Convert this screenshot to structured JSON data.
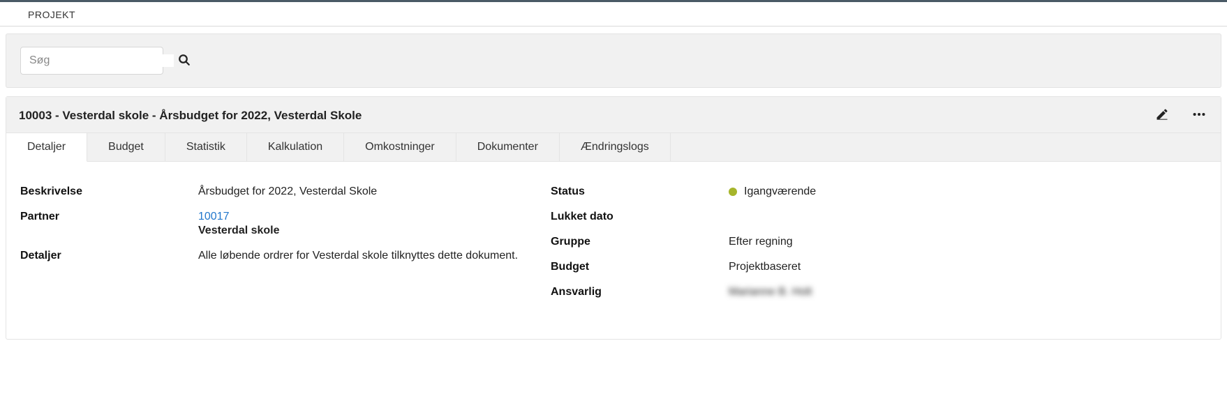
{
  "header": {
    "title": "PROJEKT"
  },
  "search": {
    "placeholder": "Søg"
  },
  "record": {
    "title": "10003 - Vesterdal skole - Årsbudget for 2022, Vesterdal Skole"
  },
  "tabs": [
    {
      "label": "Detaljer",
      "active": true
    },
    {
      "label": "Budget",
      "active": false
    },
    {
      "label": "Statistik",
      "active": false
    },
    {
      "label": "Kalkulation",
      "active": false
    },
    {
      "label": "Omkostninger",
      "active": false
    },
    {
      "label": "Dokumenter",
      "active": false
    },
    {
      "label": "Ændringslogs",
      "active": false
    }
  ],
  "details": {
    "left": {
      "beskrivelse_label": "Beskrivelse",
      "beskrivelse_value": "Årsbudget for 2022, Vesterdal Skole",
      "partner_label": "Partner",
      "partner_link": "10017",
      "partner_name": "Vesterdal skole",
      "detaljer_label": "Detaljer",
      "detaljer_value": "Alle løbende ordrer for Vesterdal skole tilknyttes dette dokument."
    },
    "right": {
      "status_label": "Status",
      "status_value": "Igangværende",
      "status_color": "#a6b52b",
      "lukket_label": "Lukket dato",
      "lukket_value": "",
      "gruppe_label": "Gruppe",
      "gruppe_value": "Efter regning",
      "budget_label": "Budget",
      "budget_value": "Projektbaseret",
      "ansvarlig_label": "Ansvarlig",
      "ansvarlig_value": "Marianne B. Holt"
    }
  }
}
